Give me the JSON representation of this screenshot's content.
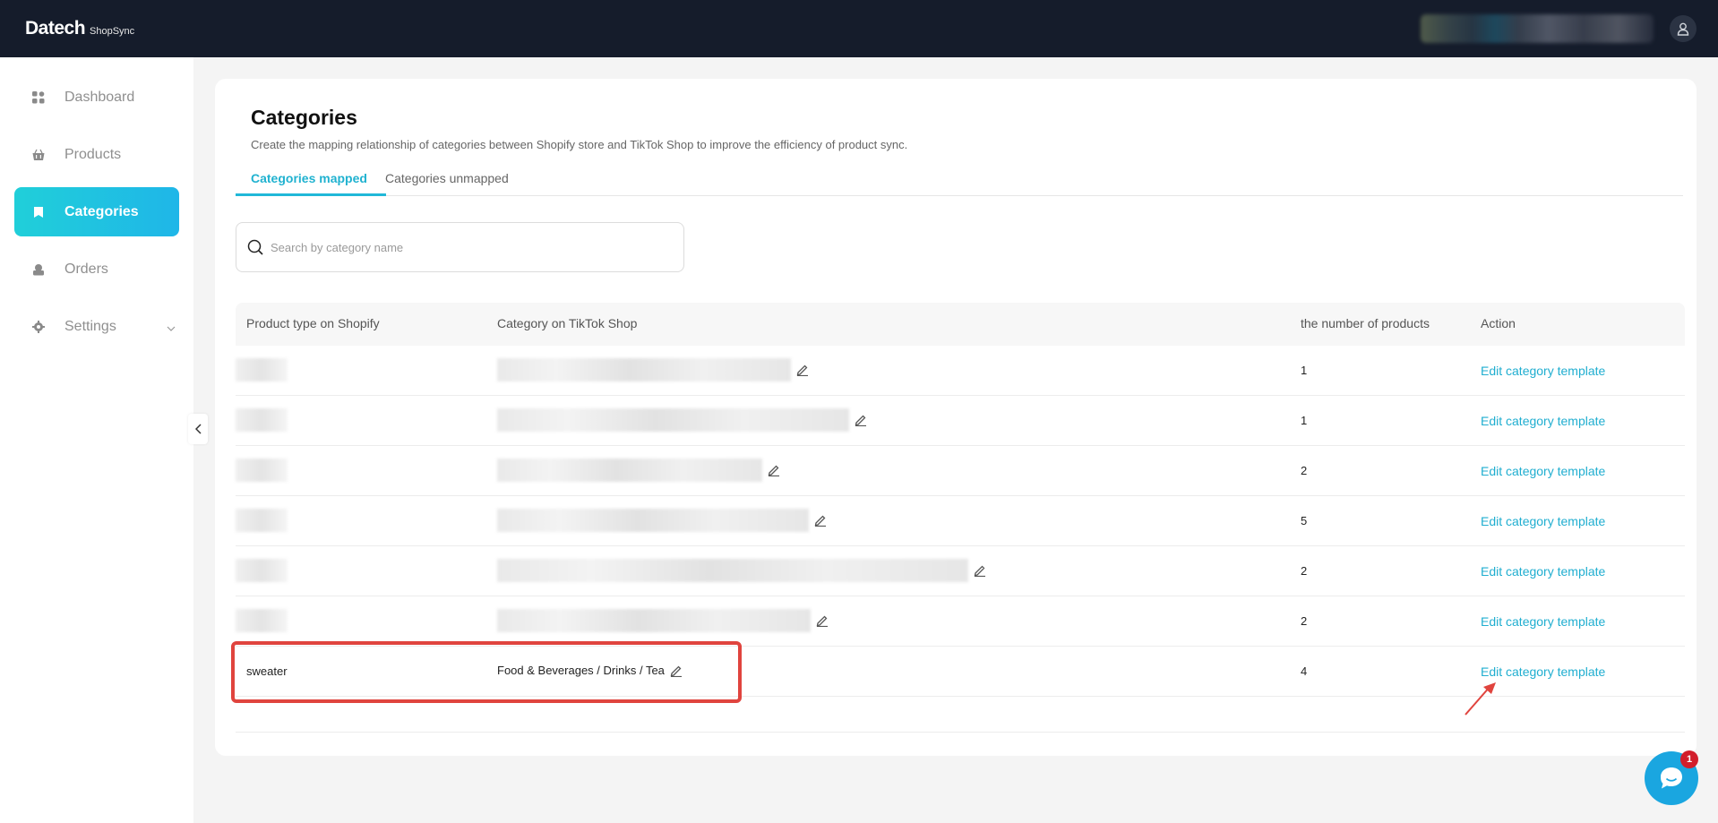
{
  "brand": {
    "name": "Datech",
    "sub": "ShopSync"
  },
  "header": {
    "account_name": "",
    "user_icon": "user-icon"
  },
  "sidebar": {
    "items": [
      {
        "label": "Dashboard",
        "icon": "dashboard-icon"
      },
      {
        "label": "Products",
        "icon": "basket-icon"
      },
      {
        "label": "Categories",
        "icon": "bookmark-icon",
        "active": true
      },
      {
        "label": "Orders",
        "icon": "orders-icon"
      },
      {
        "label": "Settings",
        "icon": "gear-icon"
      }
    ]
  },
  "page": {
    "title": "Categories",
    "description": "Create the mapping relationship of categories between Shopify store and TikTok Shop to improve the efficiency of product sync."
  },
  "tabs": [
    {
      "label": "Categories mapped",
      "active": true
    },
    {
      "label": "Categories unmapped"
    }
  ],
  "search": {
    "placeholder": "Search by category name"
  },
  "table": {
    "headers": [
      "Product type on Shopify",
      "Category on TikTok Shop",
      "the number of products",
      "Action"
    ],
    "rows": [
      {
        "product_type": "",
        "category": "",
        "count": "1",
        "action": "Edit category template"
      },
      {
        "product_type": "",
        "category": "",
        "count": "1",
        "action": "Edit category template"
      },
      {
        "product_type": "",
        "category": "",
        "count": "2",
        "action": "Edit category template"
      },
      {
        "product_type": "",
        "category": "",
        "count": "5",
        "action": "Edit category template"
      },
      {
        "product_type": "",
        "category": "",
        "count": "2",
        "action": "Edit category template"
      },
      {
        "product_type": "",
        "category": "",
        "count": "2",
        "action": "Edit category template"
      },
      {
        "product_type": "sweater",
        "category": "Food & Beverages / Drinks / Tea",
        "count": "4",
        "action": "Edit category template"
      }
    ]
  },
  "chat": {
    "badge": "1"
  },
  "colors": {
    "accent": "#20b8d8",
    "topbar": "#151c2b",
    "highlight": "#e0443e"
  }
}
